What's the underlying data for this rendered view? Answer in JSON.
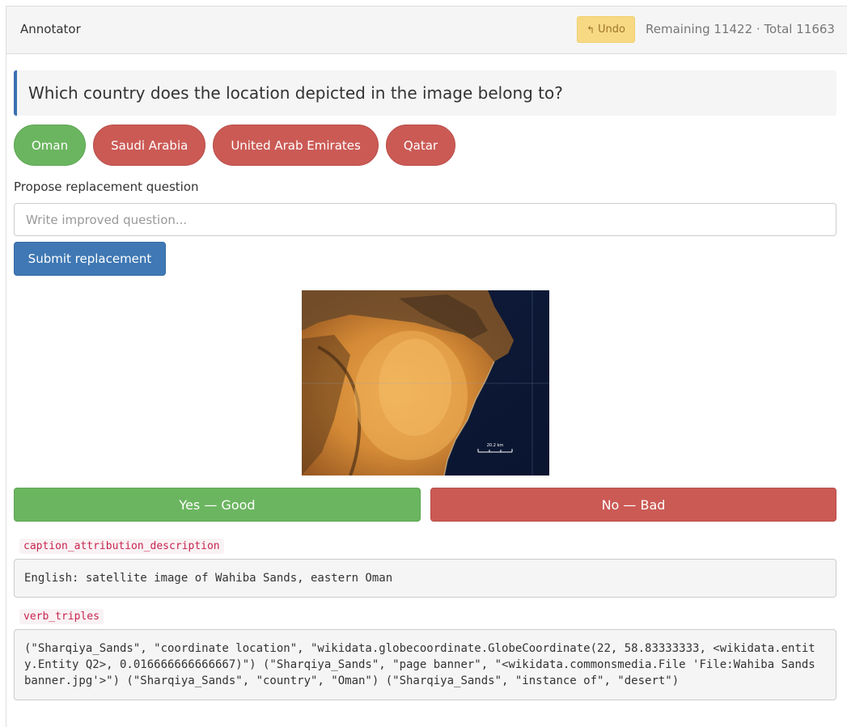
{
  "header": {
    "title": "Annotator",
    "undo_label": "Undo",
    "undo_icon": "undo-arrow-icon",
    "counts": "Remaining 11422 · Total 11663"
  },
  "question": {
    "text": "Which country does the location depicted in the image belong to?"
  },
  "answers": [
    {
      "label": "Oman",
      "color": "#6bb560"
    },
    {
      "label": "Saudi Arabia",
      "color": "#cb5a55"
    },
    {
      "label": "United Arab Emirates",
      "color": "#cb5a55"
    },
    {
      "label": "Qatar",
      "color": "#cb5a55"
    }
  ],
  "propose": {
    "label": "Propose replacement question",
    "placeholder": "Write improved question...",
    "value": "",
    "submit_label": "Submit replacement"
  },
  "image": {
    "scale_label": "20.2 km"
  },
  "judgement": {
    "yes_label": "Yes — Good",
    "no_label": "No — Bad"
  },
  "fields": [
    {
      "key": "caption_attribution_description",
      "value": "English: satellite image of Wahiba Sands, eastern Oman"
    },
    {
      "key": "verb_triples",
      "value": "(\"Sharqiya_Sands\", \"coordinate location\", \"wikidata.globecoordinate.GlobeCoordinate(22, 58.83333333, <wikidata.entity.Entity Q2>, 0.016666666666667)\") (\"Sharqiya_Sands\", \"page banner\", \"<wikidata.commonsmedia.File 'File:Wahiba Sands banner.jpg'>\") (\"Sharqiya_Sands\", \"country\", \"Oman\") (\"Sharqiya_Sands\", \"instance of\", \"desert\")"
    }
  ],
  "colors": {
    "accent_blue": "#3f78b4",
    "good_green": "#6bb560",
    "bad_red": "#cb5a55",
    "undo_yellow": "#f7d984"
  }
}
